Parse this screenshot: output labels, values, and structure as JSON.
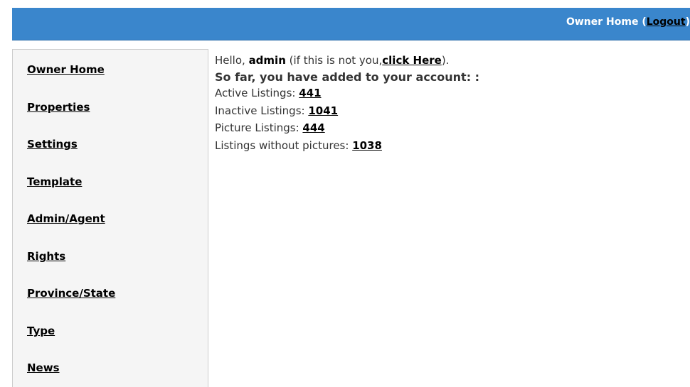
{
  "header": {
    "title": "Owner Home",
    "open_paren": " (",
    "logout_label": "Logout",
    "close_paren": ")"
  },
  "sidebar": {
    "items": [
      {
        "label": "Owner Home"
      },
      {
        "label": "Properties"
      },
      {
        "label": "Settings"
      },
      {
        "label": "Template"
      },
      {
        "label": "Admin/Agent"
      },
      {
        "label": "Rights"
      },
      {
        "label": "Province/State"
      },
      {
        "label": "Type"
      },
      {
        "label": "News"
      }
    ]
  },
  "main": {
    "greeting_prefix": "Hello, ",
    "username": "admin",
    "greeting_middle": " (if this is not you,",
    "click_here_label": "click Here",
    "greeting_suffix": ").",
    "summary_heading": "So far, you have added to your account: :",
    "stats": [
      {
        "label": "Active Listings: ",
        "value": "441"
      },
      {
        "label": "Inactive Listings: ",
        "value": "1041"
      },
      {
        "label": "Picture Listings: ",
        "value": "444"
      },
      {
        "label": "Listings without pictures: ",
        "value": "1038"
      }
    ]
  },
  "colors": {
    "header_bg": "#3a86cc",
    "sidebar_bg": "#f5f5f5",
    "link": "#000000"
  }
}
